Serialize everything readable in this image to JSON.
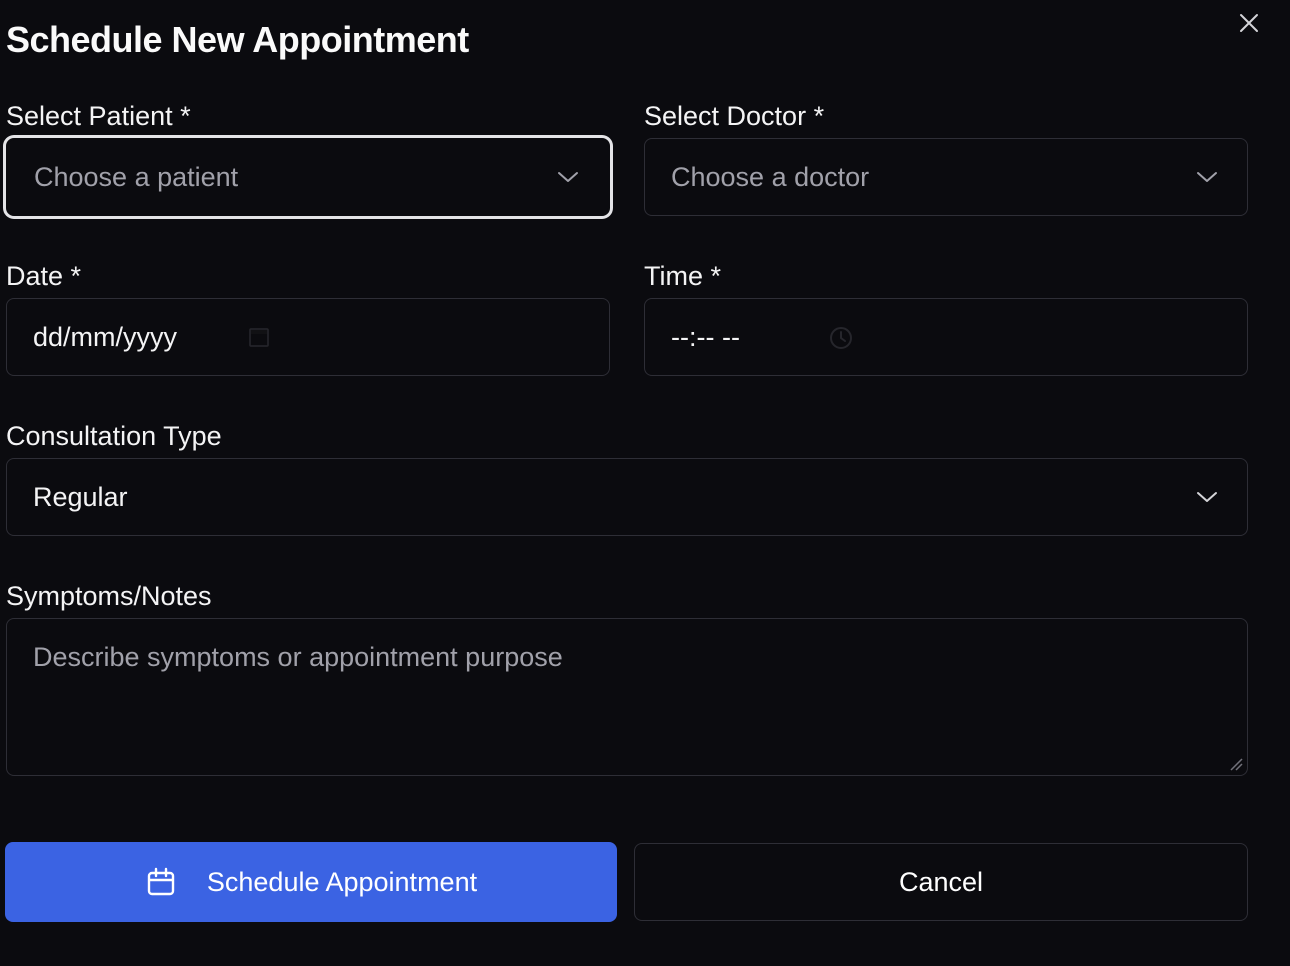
{
  "dialog": {
    "title": "Schedule New Appointment",
    "close_icon": "close-icon"
  },
  "patient": {
    "label": "Select Patient *",
    "placeholder": "Choose a patient",
    "icon": "chevron-down-icon"
  },
  "doctor": {
    "label": "Select Doctor *",
    "placeholder": "Choose a doctor",
    "icon": "chevron-down-icon"
  },
  "date": {
    "label": "Date *",
    "value": "dd/mm/yyyy",
    "icon": "calendar-icon"
  },
  "time": {
    "label": "Time *",
    "value": "--:-- --",
    "icon": "clock-icon"
  },
  "consultation": {
    "label": "Consultation Type",
    "value": "Regular",
    "icon": "chevron-down-icon"
  },
  "notes": {
    "label": "Symptoms/Notes",
    "placeholder": "Describe symptoms or appointment purpose"
  },
  "actions": {
    "schedule_label": "Schedule Appointment",
    "schedule_icon": "calendar-icon",
    "cancel_label": "Cancel"
  },
  "colors": {
    "background": "#0b0b0f",
    "border": "#2e2e36",
    "primary": "#3b63e3",
    "focus_ring": "#e4e4e7",
    "placeholder": "#a1a1aa",
    "text": "#f4f4f5"
  }
}
